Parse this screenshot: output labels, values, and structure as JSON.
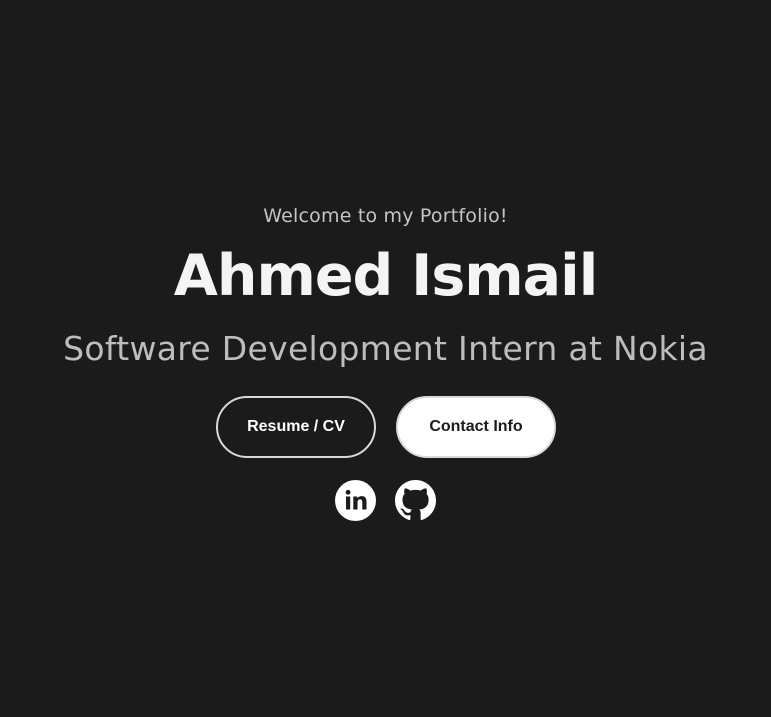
{
  "hero": {
    "welcome": "Welcome to my Portfolio!",
    "name": "Ahmed Ismail",
    "subtitle": "Software Development Intern at Nokia",
    "buttons": {
      "resume_label": "Resume / CV",
      "contact_label": "Contact Info"
    },
    "social": [
      {
        "icon": "linkedin-icon"
      },
      {
        "icon": "github-icon"
      }
    ]
  },
  "colors": {
    "background": "#1b1b1b",
    "primary_text": "#f4f4f4",
    "muted_text": "#bdbdbd",
    "button_light": "#ffffff"
  }
}
